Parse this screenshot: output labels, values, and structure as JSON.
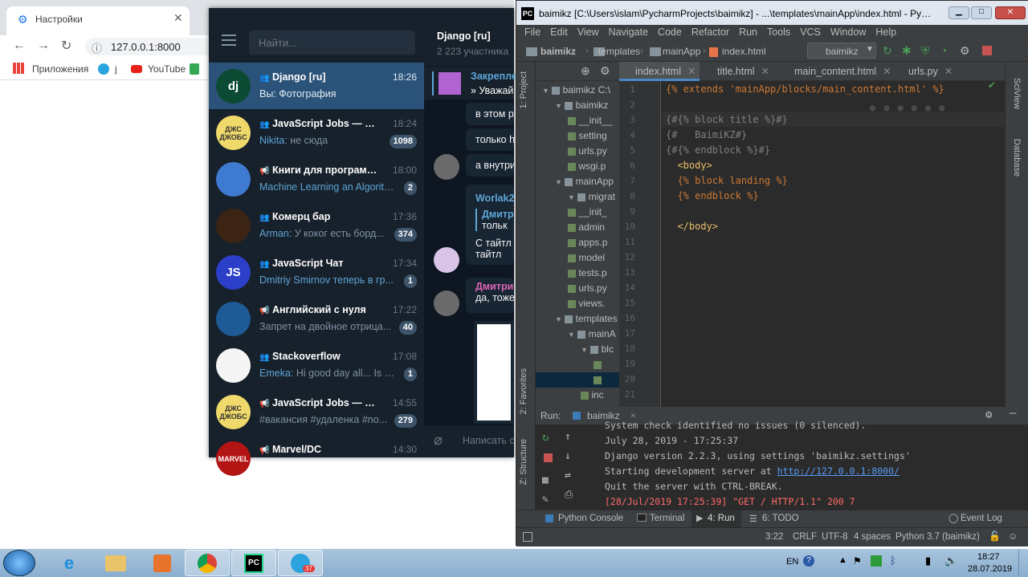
{
  "chrome": {
    "tab_title": "Настройки",
    "url": "127.0.0.1:8000",
    "bookmarks": [
      "Приложения",
      "j",
      "YouTube"
    ]
  },
  "telegram": {
    "search_placeholder": "Найти...",
    "chats": [
      {
        "avatar": "dj",
        "avatar_color": "#0c4b33",
        "name": "Django [ru]",
        "time": "18:26",
        "preview": "Вы: Фотография",
        "badge": "",
        "kind": "group"
      },
      {
        "avatar": "ДЖС ДЖОБС",
        "avatar_color": "#f0d96b",
        "name": "JavaScript Jobs — чат",
        "time": "18:24",
        "sender": "Nikita:",
        "preview": " не сюда",
        "badge": "1098",
        "kind": "group"
      },
      {
        "avatar": "",
        "avatar_color": "#3f7ad1",
        "name": "Книги для программ...",
        "time": "18:00",
        "sender": "Machine Learning an Algorith...",
        "preview": "",
        "badge": "2",
        "kind": "channel"
      },
      {
        "avatar": "",
        "avatar_color": "#3b2414",
        "name": "Комерц бар",
        "time": "17:36",
        "sender": "Arman:",
        "preview": " У коког есть борд...",
        "badge": "374",
        "kind": "group"
      },
      {
        "avatar": "JS",
        "avatar_color": "#2c3fc9",
        "name": "JavaScript Чат",
        "time": "17:34",
        "sender": "Dmitriy Smirnov теперь в гр...",
        "preview": "",
        "badge": "1",
        "kind": "group"
      },
      {
        "avatar": "",
        "avatar_color": "#1d5a96",
        "name": "Английский с нуля",
        "time": "17:22",
        "sender": "",
        "preview": "Запрет на двойное отрица...",
        "badge": "40",
        "kind": "channel"
      },
      {
        "avatar": "",
        "avatar_color": "#f5f5f5",
        "name": "Stackoverflow",
        "time": "17:08",
        "sender": "Emeka:",
        "preview": " Hi good day all...  Is it...",
        "badge": "1",
        "kind": "group"
      },
      {
        "avatar": "ДЖС ДЖОБС",
        "avatar_color": "#f0d96b",
        "name": "JavaScript Jobs — вак...",
        "time": "14:55",
        "sender": "",
        "preview": "#вакансия #удаленка #no...",
        "badge": "279",
        "kind": "channel"
      },
      {
        "avatar": "MARVEL",
        "avatar_color": "#b31414",
        "name": "Marvel/DC",
        "time": "14:30",
        "sender": "",
        "preview": "",
        "badge": "",
        "kind": "channel"
      }
    ],
    "header_title": "Django [ru]",
    "header_sub": "2 223 участника",
    "pinned_label": "Закрепле",
    "pinned_text": "» Уважай",
    "messages": [
      "в этом р",
      "только h",
      "а внутри",
      "Worlak2",
      "Дмитр",
      "тольк",
      "С тайтл",
      "тайтл",
      "Дмитри",
      "да, тоже"
    ],
    "compose_placeholder": "Написать с"
  },
  "pycharm": {
    "title": "baimikz [C:\\Users\\islam\\PycharmProjects\\baimikz] - ...\\templates\\mainApp\\index.html - PyCharm",
    "menu": [
      "File",
      "Edit",
      "View",
      "Navigate",
      "Code",
      "Refactor",
      "Run",
      "Tools",
      "VCS",
      "Window",
      "Help"
    ],
    "breadcrumb": [
      "baimikz",
      "templates",
      "mainApp",
      "index.html"
    ],
    "run_config": "baimikz",
    "tabs": [
      "index.html",
      "title.html",
      "main_content.html",
      "urls.py"
    ],
    "project_tree": [
      {
        "t": "baimikz  C:\\",
        "d": 0
      },
      {
        "t": "baimikz",
        "d": 1
      },
      {
        "t": "__init__",
        "d": 2
      },
      {
        "t": "setting",
        "d": 2
      },
      {
        "t": "urls.py",
        "d": 2
      },
      {
        "t": "wsgi.p",
        "d": 2
      },
      {
        "t": "mainApp",
        "d": 1
      },
      {
        "t": "migrat",
        "d": 2
      },
      {
        "t": "__init_",
        "d": 2
      },
      {
        "t": "admin",
        "d": 2
      },
      {
        "t": "apps.p",
        "d": 2
      },
      {
        "t": "model",
        "d": 2
      },
      {
        "t": "tests.p",
        "d": 2
      },
      {
        "t": "urls.py",
        "d": 2
      },
      {
        "t": "views.",
        "d": 2
      },
      {
        "t": "templates",
        "d": 1
      },
      {
        "t": "mainA",
        "d": 2
      },
      {
        "t": "blc",
        "d": 3
      },
      {
        "t": "",
        "d": 4
      },
      {
        "t": "",
        "d": 4
      },
      {
        "t": "inc",
        "d": 3
      }
    ],
    "code_lines": [
      "{% extends 'mainApp/blocks/main_content.html' %}",
      "",
      "{#{% block title %}#}",
      "{#   BaimiKZ#}",
      "{#{% endblock %}#}",
      "  <body>",
      "  {% block landing %}",
      "  {% endblock %}",
      "",
      "  </body>",
      "",
      "",
      "",
      "",
      "",
      "",
      "",
      "",
      "",
      "",
      ""
    ],
    "run_tab": "baimikz",
    "run_label": "Run:",
    "output": [
      "System check identified no issues (0 silenced).",
      "July 28, 2019 - 17:25:37",
      "Django version 2.2.3, using settings 'baimikz.settings'",
      "Starting development server at ",
      "Quit the server with CTRL-BREAK.",
      "[28/Jul/2019 17:25:39] \"GET / HTTP/1.1\" 200 7"
    ],
    "server_url": "http://127.0.0.1:8000/",
    "bottom_tabs": [
      "Python Console",
      "Terminal",
      "4: Run",
      "6: TODO"
    ],
    "event_log": "Event Log",
    "status": [
      "3:22",
      "CRLF",
      "UTF-8",
      "4 spaces",
      "Python 3.7 (baimikz)"
    ],
    "left_tools": [
      "1: Project",
      "2: Favorites",
      "Z: Structure"
    ],
    "right_tools": [
      "SciView",
      "Database"
    ]
  },
  "taskbar": {
    "lang": "EN",
    "time": "18:27",
    "date": "28.07.2019",
    "tg_badge": "37"
  }
}
